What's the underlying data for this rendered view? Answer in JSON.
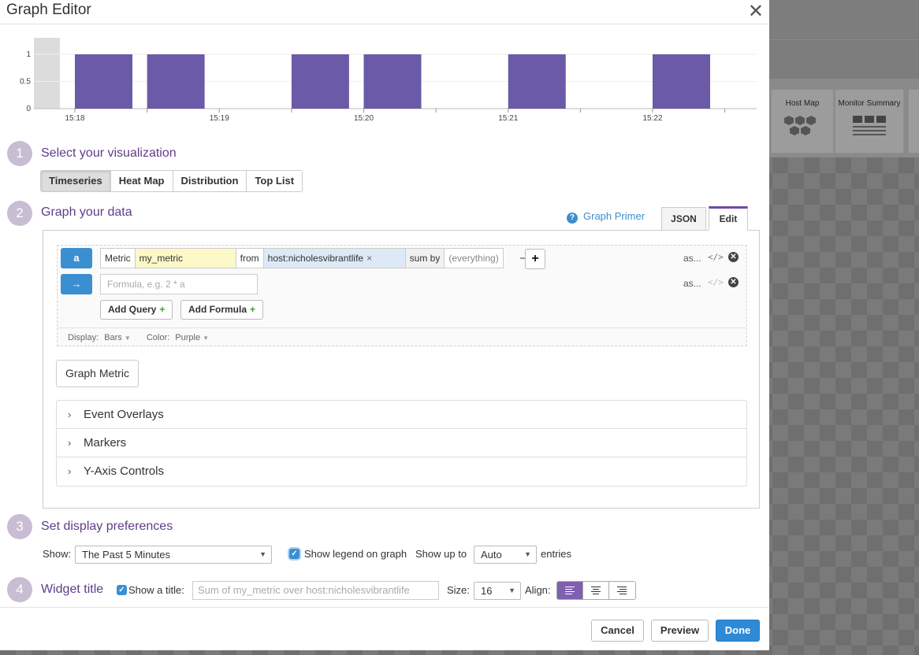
{
  "modal": {
    "title": "Graph Editor"
  },
  "preview_chart": {
    "y_ticks": [
      "1",
      "0.5",
      "0"
    ],
    "x_ticks": [
      "15:18",
      "15:19",
      "15:20",
      "15:21",
      "15:22"
    ],
    "bar_color": "#6a5aa8"
  },
  "chart_data": {
    "type": "bar",
    "ylim": [
      0,
      1
    ],
    "x": [
      "15:18",
      "15:18:30",
      "15:19:30",
      "15:20",
      "15:21",
      "15:22"
    ],
    "values": [
      1,
      1,
      1,
      1,
      1,
      1
    ]
  },
  "steps": [
    {
      "num": "1",
      "title": "Select your visualization"
    },
    {
      "num": "2",
      "title": "Graph your data"
    },
    {
      "num": "3",
      "title": "Set display preferences"
    },
    {
      "num": "4",
      "title": "Widget title"
    }
  ],
  "viz_tabs": [
    "Timeseries",
    "Heat Map",
    "Distribution",
    "Top List"
  ],
  "editor": {
    "primer_label": "Graph Primer",
    "json_tab": "JSON",
    "edit_tab": "Edit",
    "query": {
      "badge": "a",
      "metric_label": "Metric",
      "metric_value": "my_metric",
      "from_label": "from",
      "host_tag": "host:nicholesvibrantlife",
      "sum_by_label": "sum by",
      "sum_by_value": "(everything)",
      "as_label": "as..."
    },
    "formula": {
      "badge": "→",
      "placeholder": "Formula, e.g. 2 * a",
      "as_label": "as..."
    },
    "add_query": "Add Query",
    "add_formula": "Add Formula",
    "display_label": "Display:",
    "display_value": "Bars",
    "color_label": "Color:",
    "color_value": "Purple",
    "graph_metric": "Graph Metric",
    "accordion": [
      "Event Overlays",
      "Markers",
      "Y-Axis Controls"
    ]
  },
  "prefs": {
    "show_label": "Show:",
    "show_value": "The Past 5 Minutes",
    "legend_label": "Show legend on graph",
    "show_up_to": "Show up to",
    "entries_value": "Auto",
    "entries_label": "entries"
  },
  "widget_title": {
    "show_title_label": "Show a title:",
    "placeholder": "Sum of my_metric over host:nicholesvibrantlife",
    "size_label": "Size:",
    "size_value": "16",
    "align_label": "Align:"
  },
  "footer": {
    "cancel": "Cancel",
    "preview": "Preview",
    "done": "Done"
  },
  "background": {
    "tiles": [
      "Host Map",
      "Monitor Summary"
    ]
  }
}
